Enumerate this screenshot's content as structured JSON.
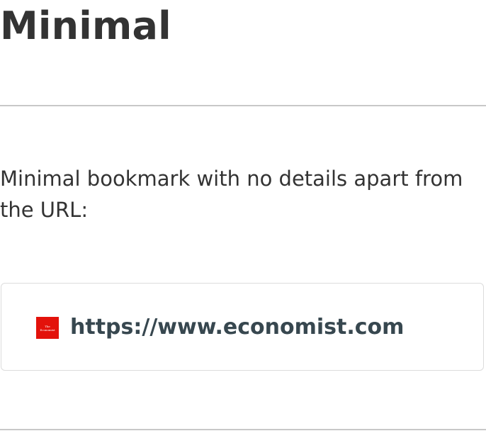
{
  "page": {
    "title": "Minimal",
    "intro_text": "Minimal bookmark with no details apart from the URL:"
  },
  "bookmark": {
    "url": "https://www.economist.com",
    "favicon": {
      "icon_name": "economist-logo-icon",
      "background_color": "#e3120b",
      "text_line1": "The",
      "text_line2": "Economist"
    }
  },
  "colors": {
    "text": "#333333",
    "url_text": "#37474f",
    "divider": "#c8c8c8",
    "card_border": "#dcdcdc"
  }
}
